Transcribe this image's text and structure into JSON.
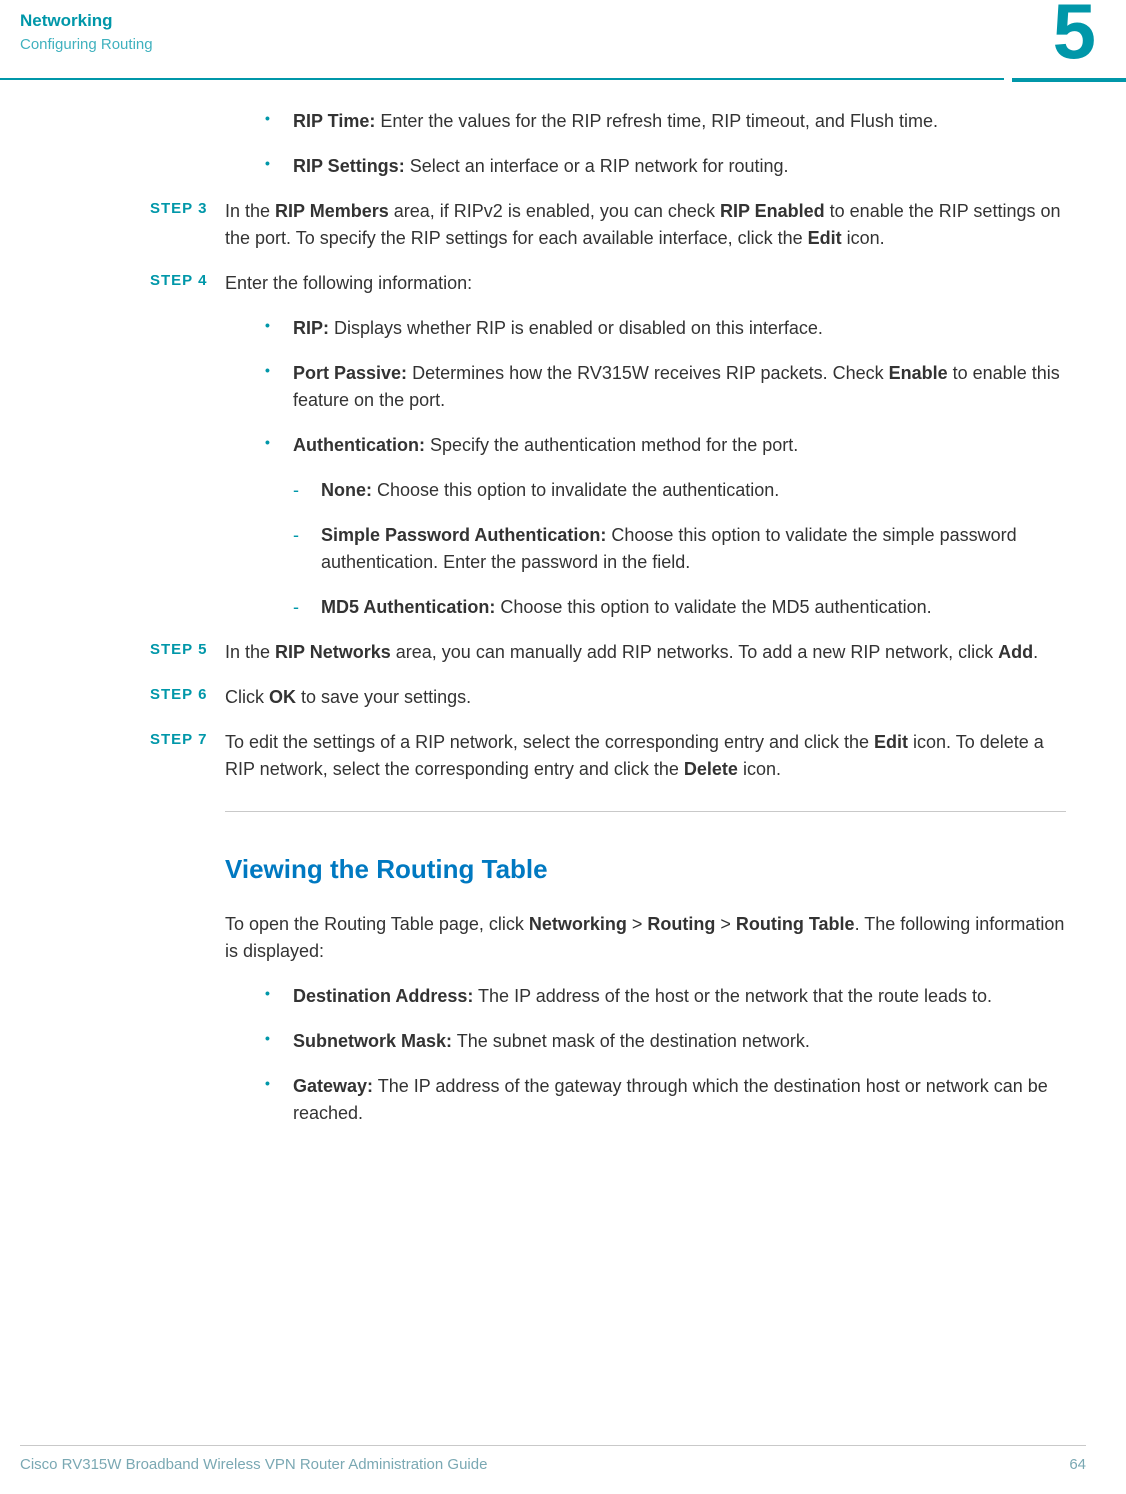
{
  "header": {
    "title": "Networking",
    "subtitle": "Configuring Routing",
    "chapter": "5"
  },
  "intro_bullets": [
    {
      "label": "RIP Time:",
      "text": " Enter the values for the RIP refresh time, RIP timeout, and Flush time."
    },
    {
      "label": "RIP Settings:",
      "text": " Select an interface or a RIP network for routing."
    }
  ],
  "steps": {
    "s3": {
      "num": "STEP  3",
      "pre": "In the ",
      "b1": "RIP Members",
      "mid1": " area, if RIPv2 is enabled, you can check ",
      "b2": "RIP Enabled",
      "mid2": " to enable the RIP settings on the port. To specify the RIP settings for each available interface, click the ",
      "b3": "Edit",
      "post": " icon."
    },
    "s4": {
      "num": "STEP  4",
      "text": "Enter the following information:"
    },
    "s4_bullets": [
      {
        "label": "RIP:",
        "text": " Displays whether RIP is enabled or disabled on this interface."
      },
      {
        "label": "Port Passive:",
        "pre": " Determines how the RV315W receives RIP packets. Check ",
        "b1": "Enable",
        "post": " to enable this feature on the port."
      },
      {
        "label": "Authentication:",
        "text": " Specify the authentication method for the port."
      }
    ],
    "s4_sub": [
      {
        "label": "None:",
        "text": " Choose this option to invalidate the authentication."
      },
      {
        "label": "Simple Password Authentication:",
        "text": " Choose this option to validate the simple password authentication. Enter the password in the field."
      },
      {
        "label": "MD5 Authentication:",
        "text": " Choose this option to validate the MD5 authentication."
      }
    ],
    "s5": {
      "num": "STEP  5",
      "pre": "In the ",
      "b1": "RIP Networks",
      "mid": " area, you can manually add RIP networks. To add a new RIP network, click ",
      "b2": "Add",
      "post": "."
    },
    "s6": {
      "num": "STEP  6",
      "pre": "Click ",
      "b1": "OK",
      "post": " to save your settings."
    },
    "s7": {
      "num": "STEP  7",
      "pre": "To edit the settings of a RIP network, select the corresponding entry and click the ",
      "b1": "Edit",
      "mid": " icon. To delete a RIP network, select the corresponding entry and click the ",
      "b2": "Delete",
      "post": " icon."
    }
  },
  "section2": {
    "heading": "Viewing the Routing Table",
    "intro_pre": "To open the Routing Table page, click ",
    "nav1": "Networking",
    "sep": " > ",
    "nav2": "Routing",
    "nav3": "Routing Table",
    "intro_post": ". The following information is displayed:",
    "bullets": [
      {
        "label": "Destination Address:",
        "text": " The IP address of the host or the network that the route leads to."
      },
      {
        "label": "Subnetwork Mask:",
        "text": " The subnet mask of the destination network."
      },
      {
        "label": "Gateway:",
        "text": " The IP address of the gateway through which the destination host or network can be reached."
      }
    ]
  },
  "footer": {
    "left": "Cisco RV315W Broadband Wireless VPN Router Administration Guide",
    "right": "64"
  }
}
